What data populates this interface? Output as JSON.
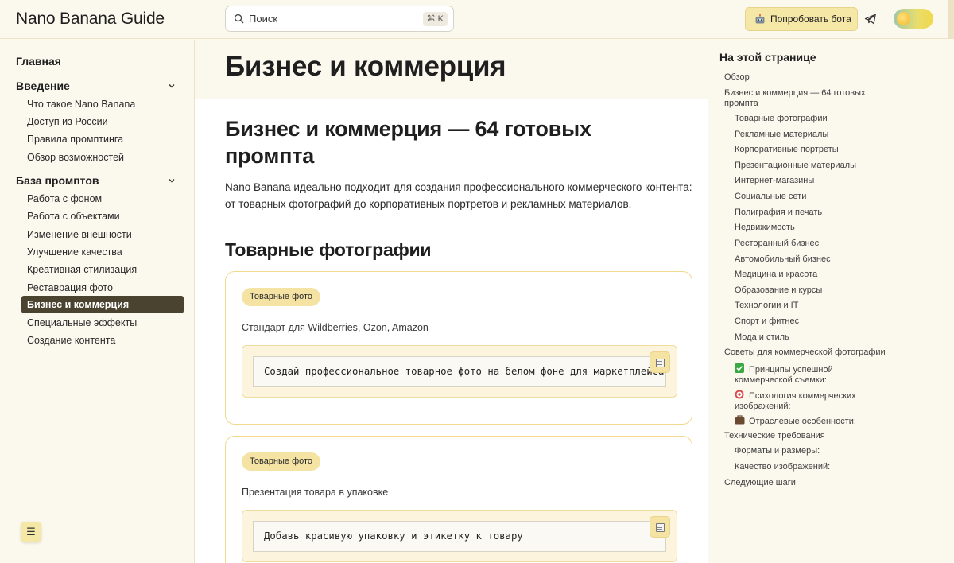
{
  "header": {
    "site_title": "Nano Banana Guide",
    "search_placeholder": "Поиск",
    "search_shortcut": "⌘ K",
    "try_bot_label": "Попробовать бота",
    "try_bot_icon": "robot-icon",
    "telegram_icon": "telegram-icon"
  },
  "sidebar": {
    "home": "Главная",
    "sections": [
      {
        "title": "Введение",
        "items": [
          "Что такое Nano Banana",
          "Доступ из России",
          "Правила промптинга",
          "Обзор возможностей"
        ]
      },
      {
        "title": "База промптов",
        "items": [
          "Работа с фоном",
          "Работа с объектами",
          "Изменение внешности",
          "Улучшение качества",
          "Креативная стилизация",
          "Реставрация фото",
          "Бизнес и коммерция",
          "Специальные эффекты",
          "Создание контента"
        ]
      }
    ],
    "active_item": "Бизнес и коммерция",
    "menu_button": "☰"
  },
  "main": {
    "page_title": "Бизнес и коммерция",
    "heading": "Бизнес и коммерция — 64 готовых промпта",
    "intro": "Nano Banana идеально подходит для создания профессионального коммерческого контента: от товарных фотографий до корпоративных портретов и рекламных материалов.",
    "section_heading": "Товарные фотографии",
    "cards": [
      {
        "badge": "Товарные фото",
        "description": "Стандарт для Wildberries, Ozon, Amazon",
        "prompt": "Создай профессиональное товарное фото на белом фоне для маркетплейса"
      },
      {
        "badge": "Товарные фото",
        "description": "Презентация товара в упаковке",
        "prompt": "Добавь красивую упаковку и этикетку к товару"
      }
    ]
  },
  "toc": {
    "title": "На этой странице",
    "items": [
      {
        "label": "Обзор",
        "level": 1
      },
      {
        "label": "Бизнес и коммерция — 64 готовых промпта",
        "level": 1
      },
      {
        "label": "Товарные фотографии",
        "level": 2
      },
      {
        "label": "Рекламные материалы",
        "level": 2
      },
      {
        "label": "Корпоративные портреты",
        "level": 2
      },
      {
        "label": "Презентационные материалы",
        "level": 2
      },
      {
        "label": "Интернет-магазины",
        "level": 2
      },
      {
        "label": "Социальные сети",
        "level": 2
      },
      {
        "label": "Полиграфия и печать",
        "level": 2
      },
      {
        "label": "Недвижимость",
        "level": 2
      },
      {
        "label": "Ресторанный бизнес",
        "level": 2
      },
      {
        "label": "Автомобильный бизнес",
        "level": 2
      },
      {
        "label": "Медицина и красота",
        "level": 2
      },
      {
        "label": "Образование и курсы",
        "level": 2
      },
      {
        "label": "Технологии и IT",
        "level": 2
      },
      {
        "label": "Спорт и фитнес",
        "level": 2
      },
      {
        "label": "Мода и стиль",
        "level": 2
      },
      {
        "label": "Советы для коммерческой фотографии",
        "level": 1
      },
      {
        "label": "Принципы успешной коммерческой съемки:",
        "level": 2,
        "icon": "check-mark-icon",
        "icon_color": "#3aa845"
      },
      {
        "label": "Психология коммерческих изображений:",
        "level": 2,
        "icon": "target-icon",
        "icon_color": "#d94b4b"
      },
      {
        "label": "Отраслевые особенности:",
        "level": 2,
        "icon": "briefcase-icon",
        "icon_color": "#6b4a33"
      },
      {
        "label": "Технические требования",
        "level": 1
      },
      {
        "label": "Форматы и размеры:",
        "level": 2
      },
      {
        "label": "Качество изображений:",
        "level": 2
      },
      {
        "label": "Следующие шаги",
        "level": 1
      }
    ]
  },
  "colors": {
    "background": "#fbf8ee",
    "accent": "#f5e7a6",
    "active_nav": "#4a4330",
    "card_border": "#f0d98c"
  }
}
